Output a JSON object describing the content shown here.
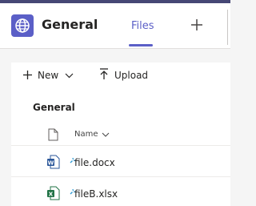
{
  "header": {
    "channel_name": "General",
    "tabs": [
      {
        "label": "Files",
        "active": true
      }
    ],
    "add_tab_icon": "plus-icon",
    "team_icon": "globe-icon"
  },
  "commandbar": {
    "new_label": "New",
    "upload_label": "Upload"
  },
  "section": {
    "title": "General",
    "columns": [
      {
        "label": "Name"
      }
    ]
  },
  "files": [
    {
      "name": "file.docx",
      "type": "word"
    },
    {
      "name": "fileB.xlsx",
      "type": "excel"
    }
  ],
  "colors": {
    "accent": "#5b5fc7",
    "word": "#2b579a",
    "excel": "#217346"
  }
}
